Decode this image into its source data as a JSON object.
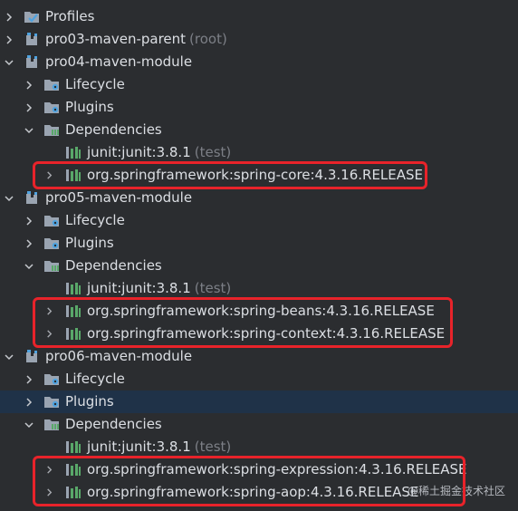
{
  "tree": {
    "profiles": {
      "label": "Profiles"
    },
    "pro03": {
      "label": "pro03-maven-parent",
      "suffix": "(root)"
    },
    "pro04": {
      "label": "pro04-maven-module",
      "lifecycle": "Lifecycle",
      "plugins": "Plugins",
      "dependencies": "Dependencies",
      "deps": [
        {
          "label": "junit:junit:3.8.1",
          "scope": "(test)"
        },
        {
          "label": "org.springframework:spring-core:4.3.16.RELEASE"
        }
      ]
    },
    "pro05": {
      "label": "pro05-maven-module",
      "lifecycle": "Lifecycle",
      "plugins": "Plugins",
      "dependencies": "Dependencies",
      "deps": [
        {
          "label": "junit:junit:3.8.1",
          "scope": "(test)"
        },
        {
          "label": "org.springframework:spring-beans:4.3.16.RELEASE"
        },
        {
          "label": "org.springframework:spring-context:4.3.16.RELEASE"
        }
      ]
    },
    "pro06": {
      "label": "pro06-maven-module",
      "lifecycle": "Lifecycle",
      "plugins": "Plugins",
      "dependencies": "Dependencies",
      "deps": [
        {
          "label": "junit:junit:3.8.1",
          "scope": "(test)"
        },
        {
          "label": "org.springframework:spring-expression:4.3.16.RELEASE"
        },
        {
          "label": "org.springframework:spring-aop:4.3.16.RELEASE"
        }
      ]
    }
  },
  "watermark": "@稀土掘金技术社区"
}
